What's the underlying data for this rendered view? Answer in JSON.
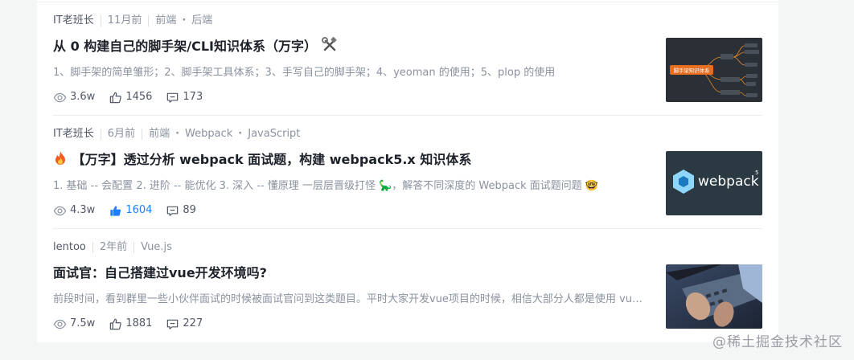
{
  "articles": [
    {
      "author": "IT老班长",
      "time": "11月前",
      "tags": [
        "前端",
        "后端"
      ],
      "title": "从 0 构建自己的脚手架/CLI知识体系（万字）",
      "title_suffix_icon": "hammer-wrench-icon",
      "abstract": "1、脚手架的简单雏形；2、脚手架工具体系；3、手写自己的脚手架；4、yeoman 的使用；5、plop 的使用",
      "views": "3.6w",
      "likes": "1456",
      "comments": "173",
      "liked": false,
      "thumbnail": "mind-map-thumbnail",
      "thumbnail_text": "脚手架知识体系"
    },
    {
      "author": "IT老班长",
      "time": "6月前",
      "tags": [
        "前端",
        "Webpack",
        "JavaScript"
      ],
      "title_prefix_icon": "fire-icon",
      "title": "【万字】透过分析 webpack 面试题，构建 webpack5.x 知识体系",
      "abstract": "1. 基础 -- 会配置 2. 进阶 -- 能优化 3. 深入 -- 懂原理 一层层晋级打怪 🦕，解答不同深度的 Webpack 面试题问题 🤓",
      "views": "4.3w",
      "likes": "1604",
      "comments": "89",
      "liked": true,
      "thumbnail": "webpack-logo-thumbnail",
      "thumbnail_text": "webpack",
      "thumbnail_sup": "5"
    },
    {
      "author": "lentoo",
      "time": "2年前",
      "tags": [
        "Vue.js"
      ],
      "title": "面试官：自己搭建过vue开发环境吗?",
      "abstract": "前段时间，看到群里一些小伙伴面试的时候被面试官问到这类题目。平时大家开发vue项目的时候，相信大部分人都是使用 vue...",
      "views": "7.5w",
      "likes": "1881",
      "comments": "227",
      "liked": false,
      "thumbnail": "laptop-photo-thumbnail"
    }
  ],
  "watermark": "@稀土掘金技术社区",
  "colors": {
    "accent": "#1e80ff",
    "title": "#1d2129",
    "meta": "#8a919f",
    "background": "#f4f5f5"
  }
}
